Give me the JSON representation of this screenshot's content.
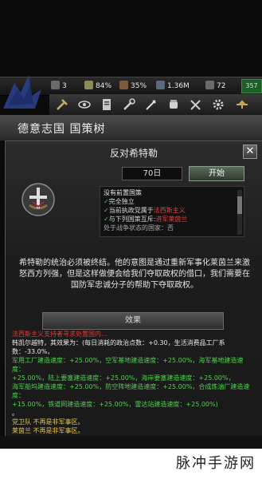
{
  "resources": {
    "divisions": "3",
    "stability": "84%",
    "war_support": "35%",
    "manpower": "1.36M",
    "factories": "72",
    "right_value": "357"
  },
  "window": {
    "title": "德意志国 国策树"
  },
  "focus": {
    "title": "反对希特勒",
    "days": "70日",
    "start_label": "开始"
  },
  "requirements": {
    "header": "没有前置国策",
    "lines": [
      {
        "check": "✓",
        "text": "完全独立"
      },
      {
        "check": "✓",
        "text": "当前执政党属于",
        "highlight": "法西斯主义"
      },
      {
        "check": "✓",
        "text": "与下列国策互斥:",
        "highlight": "进军莱茵兰"
      }
    ],
    "cut_line": "处于战争状态的国家：否"
  },
  "description": "希特勒的统治必须被终结。他的意图是通过重新军事化莱茵兰来激怒西方列强，但是这样做便会给我们夺取政权的借口，我们需要在国防军忠诚分子的帮助下夺取政权。",
  "effects": {
    "label": "效果",
    "lines": [
      {
        "cls": "red",
        "text": "法西斯主义支持者寻求处置国内..."
      },
      {
        "cls": "wht",
        "text": "韩凯尔越特，其效果为：(每日消耗的政治点数：+0.30，生活消费品工厂系数：-33.0%，"
      },
      {
        "cls": "wht",
        "text": "军用工厂建造速度：+25.00%，空军基地建造速度：+25.00%，海军基地建造速度："
      },
      {
        "cls": "wht",
        "text": "+25.00%，陆上要塞建造速度：+25.00%，海岸要塞建造速度：+25.00%，"
      },
      {
        "cls": "wht",
        "text": "海军船坞建造速度：+25.00%，防空阵地建造速度：+25.00%，合成炼油厂建造速度："
      },
      {
        "cls": "wht",
        "text": "+15.00%，铁道网建造速度：+25.00%，雷达站建造速度：+25.00%)"
      },
      {
        "cls": "wht",
        "text": "。"
      },
      {
        "cls": "yel",
        "text": "党卫队 不再是非军事区。"
      },
      {
        "cls": "yel",
        "text": "莱茵兰 不再是非军事区。"
      }
    ]
  },
  "watermark": "脉冲手游网",
  "colors": {
    "accent_green": "#4fcf4f",
    "accent_red": "#e03a3a",
    "accent_yellow": "#e2c64a"
  }
}
